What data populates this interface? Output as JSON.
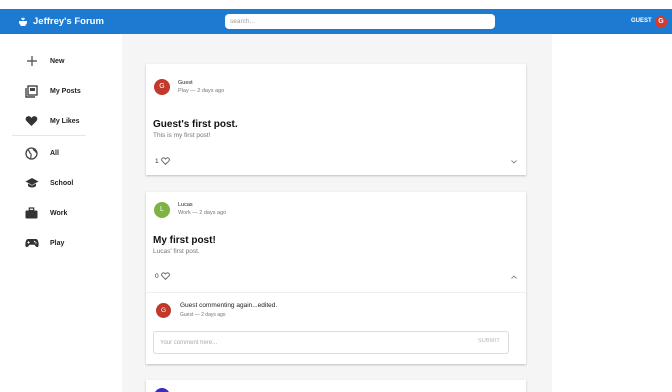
{
  "app": {
    "brand": "Jeffrey's Forum",
    "search_placeholder": "search...",
    "user_label": "GUEST",
    "user_initial": "G"
  },
  "sidebar": {
    "items": [
      {
        "label": "New",
        "icon": "plus-icon"
      },
      {
        "label": "My Posts",
        "icon": "posts-icon"
      },
      {
        "label": "My Likes",
        "icon": "heart-icon"
      },
      {
        "label": "All",
        "icon": "globe-icon"
      },
      {
        "label": "School",
        "icon": "school-icon"
      },
      {
        "label": "Work",
        "icon": "briefcase-icon"
      },
      {
        "label": "Play",
        "icon": "gamepad-icon"
      }
    ]
  },
  "posts": [
    {
      "author": "Guest",
      "initial": "G",
      "avatar_color": "#c0392b",
      "meta": "Play — 2 days ago",
      "title": "Guest's first post.",
      "body": "This is my first post!",
      "likes": "1",
      "expanded": false
    },
    {
      "author": "Lucas",
      "initial": "L",
      "avatar_color": "#7cb342",
      "meta": "Work — 2 days ago",
      "title": "My first post!",
      "body": "Lucas' first post.",
      "likes": "0",
      "expanded": true,
      "comments": [
        {
          "initial": "G",
          "avatar_color": "#c0392b",
          "text": "Guest commenting again...edited.",
          "meta": "Guest — 2 days ago"
        }
      ],
      "comment_placeholder": "Your comment here...",
      "submit_label": "SUBMIT"
    }
  ],
  "colors": {
    "appbar": "#1e7ad1",
    "feed_background": "#f5f5f5",
    "third_avatar": "#3b2bbf"
  }
}
